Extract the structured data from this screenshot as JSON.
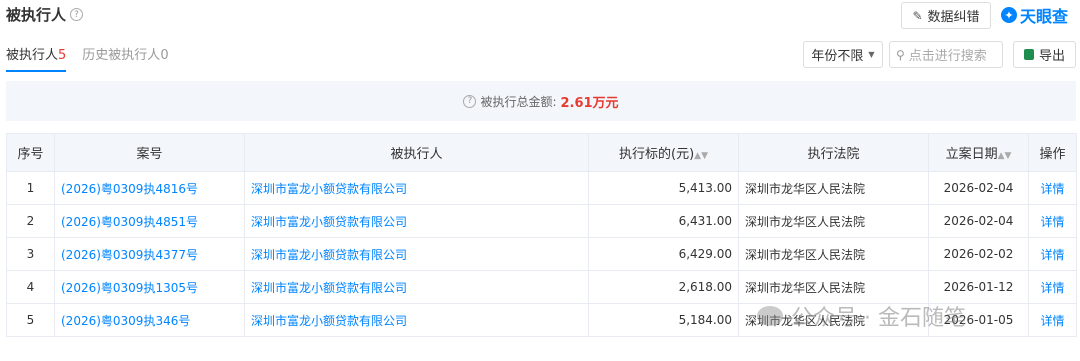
{
  "header": {
    "title": "被执行人",
    "help_glyph": "?",
    "correct_label": "数据纠错",
    "logo_text": "天眼查"
  },
  "tabs": [
    {
      "label": "被执行人",
      "count": "5"
    },
    {
      "label": "历史被执行人",
      "count": "0"
    }
  ],
  "toolbar": {
    "year_filter": "年份不限",
    "search_placeholder": "点击进行搜索",
    "export_label": "导出"
  },
  "summary": {
    "label": "被执行总金额:",
    "amount": "2.61万元"
  },
  "table": {
    "headers": {
      "index": "序号",
      "case_no": "案号",
      "executed_party": "被执行人",
      "amount": "执行标的(元)",
      "court": "执行法院",
      "filing_date": "立案日期",
      "action": "操作"
    },
    "rows": [
      {
        "index": "1",
        "case_no": "(2026)粤0309执4816号",
        "party": "深圳市富龙小额贷款有限公司",
        "amount": "5,413.00",
        "court": "深圳市龙华区人民法院",
        "date": "2026-02-04",
        "action": "详情"
      },
      {
        "index": "2",
        "case_no": "(2026)粤0309执4851号",
        "party": "深圳市富龙小额贷款有限公司",
        "amount": "6,431.00",
        "court": "深圳市龙华区人民法院",
        "date": "2026-02-04",
        "action": "详情"
      },
      {
        "index": "3",
        "case_no": "(2026)粤0309执4377号",
        "party": "深圳市富龙小额贷款有限公司",
        "amount": "6,429.00",
        "court": "深圳市龙华区人民法院",
        "date": "2026-02-02",
        "action": "详情"
      },
      {
        "index": "4",
        "case_no": "(2026)粤0309执1305号",
        "party": "深圳市富龙小额贷款有限公司",
        "amount": "2,618.00",
        "court": "深圳市龙华区人民法院",
        "date": "2026-01-12",
        "action": "详情"
      },
      {
        "index": "5",
        "case_no": "(2026)粤0309执346号",
        "party": "深圳市富龙小额贷款有限公司",
        "amount": "5,184.00",
        "court": "深圳市龙华区人民法院",
        "date": "2026-01-05",
        "action": "详情"
      }
    ]
  },
  "watermark": {
    "text": "公众号 · 金石随笔"
  }
}
